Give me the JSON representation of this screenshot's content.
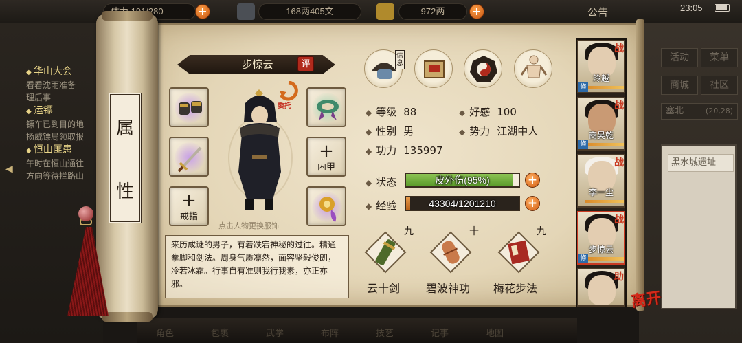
{
  "topbar": {
    "stamina": "体力 191/280",
    "copper": "168两405文",
    "silver": "972两",
    "notice": "公告",
    "clock": "23:05"
  },
  "quests": [
    {
      "title": "华山大会",
      "lines": [
        "看看沈雨准备",
        "理后事"
      ]
    },
    {
      "title": "运镖",
      "lines": [
        "镖车已到目的地",
        "扬威镖局领取报"
      ]
    },
    {
      "title": "恒山匪患",
      "lines": [
        "午时在恒山通往",
        "方向等待拦路山"
      ]
    }
  ],
  "side_menu": {
    "buttons": [
      "活动",
      "菜单",
      "商城",
      "社区"
    ],
    "location": "塞北",
    "coords": "(20,28)",
    "list_item": "黑水城遗址"
  },
  "bottom_bar": [
    "角色",
    "包裹",
    "武学",
    "布阵",
    "技艺",
    "记事",
    "地图"
  ],
  "scroll": {
    "rod_chars": [
      "属",
      "性"
    ]
  },
  "character": {
    "name": "步惊云",
    "eval_label": "评",
    "commission_label": "委托",
    "change_clothes_hint": "点击人物更换服饰",
    "slots": {
      "armor_label": "内甲",
      "ring_label": "戒指"
    },
    "description": "来历成谜的男子，有着跌宕神秘的过往。精通拳脚和剑法。周身气质凛然，面容坚毅俊朗，冷若冰霜。行事自有准则我行我素，亦正亦邪。"
  },
  "top_icons": [
    {
      "name": "info",
      "tag": "信息"
    },
    {
      "name": "scroll"
    },
    {
      "name": "bagua"
    },
    {
      "name": "meridian"
    }
  ],
  "stats": {
    "level_label": "等级",
    "level": "88",
    "favor_label": "好感",
    "favor": "100",
    "gender_label": "性别",
    "gender": "男",
    "faction_label": "势力",
    "faction": "江湖中人",
    "power_label": "功力",
    "power": "135997",
    "status_label": "状态",
    "status_text": "皮外伤(95%)",
    "status_fraction": 0.95,
    "exp_label": "经验",
    "exp_text": "43304/1201210",
    "exp_fraction": 0.036
  },
  "skills": [
    {
      "level": "九",
      "name": "云十剑"
    },
    {
      "level": "十",
      "name": "碧波神功"
    },
    {
      "level": "九",
      "name": "梅花步法"
    }
  ],
  "party": [
    {
      "name": "泠越",
      "role": "战"
    },
    {
      "name": "商昊乾",
      "role": "战"
    },
    {
      "name": "李一尘",
      "role": "战"
    },
    {
      "name": "步惊云",
      "role": "战"
    },
    {
      "name": "",
      "role": "助"
    }
  ],
  "party_xiu": "修",
  "leave_label": "离开",
  "colors": {
    "status_fill": "#6fa53a",
    "exp_fill": "#d07a2a",
    "accent_red": "#c93a22"
  }
}
